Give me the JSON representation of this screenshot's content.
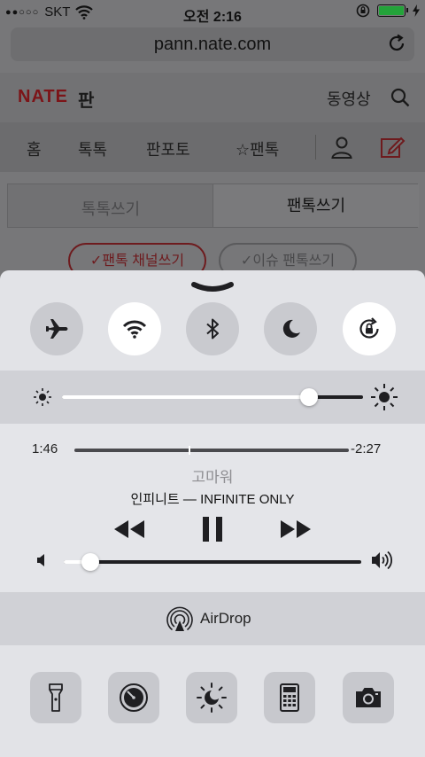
{
  "status_bar": {
    "signal_dots": "●●○○○",
    "carrier": "SKT",
    "time": "오전 2:16",
    "wifi_icon": "wifi-icon",
    "lock_icon": "rotation-lock-icon",
    "battery_color": "#24a33a"
  },
  "browser": {
    "url": "pann.nate.com",
    "reload_icon": "reload-icon"
  },
  "page": {
    "logo": "NATE",
    "section": "판",
    "video_link": "동영상",
    "nav": [
      "홈",
      "톡톡",
      "판포토",
      "☆팬톡"
    ],
    "write_tabs": [
      "톡톡쓰기",
      "팬톡쓰기"
    ],
    "pills": [
      "✓팬톡 채널쓰기",
      "✓이슈 팬톡쓰기"
    ]
  },
  "control_center": {
    "toggles": [
      {
        "name": "airplane-mode",
        "icon": "airplane-icon",
        "on": false
      },
      {
        "name": "wifi",
        "icon": "wifi-icon",
        "on": true
      },
      {
        "name": "bluetooth",
        "icon": "bluetooth-icon",
        "on": false
      },
      {
        "name": "do-not-disturb",
        "icon": "moon-icon",
        "on": false
      },
      {
        "name": "rotation-lock",
        "icon": "rotation-lock-icon",
        "on": true
      }
    ],
    "brightness": 0.82,
    "media": {
      "elapsed": "1:46",
      "remaining": "-2:27",
      "progress": 0.42,
      "title": "고마워",
      "artist": "인피니트 — INFINITE ONLY",
      "volume": 0.09
    },
    "airdrop_label": "AirDrop",
    "shortcuts": [
      {
        "name": "flashlight",
        "icon": "flashlight-icon"
      },
      {
        "name": "timer",
        "icon": "timer-icon"
      },
      {
        "name": "night-shift",
        "icon": "night-shift-icon"
      },
      {
        "name": "calculator",
        "icon": "calculator-icon"
      },
      {
        "name": "camera",
        "icon": "camera-icon"
      }
    ]
  }
}
